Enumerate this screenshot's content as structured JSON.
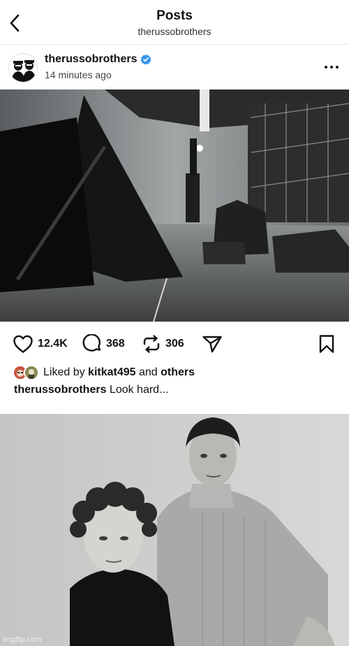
{
  "header": {
    "title": "Posts",
    "subtitle": "therussobrothers",
    "back_icon": "chevron-left-icon"
  },
  "post": {
    "username": "therussobrothers",
    "verified_icon": "verified-badge-icon",
    "verified_color": "#3897f0",
    "time": "14 minutes ago",
    "more_icon": "more-horizontal-icon",
    "image_icon": "studio-set-photo"
  },
  "actions": {
    "likes": "12.4K",
    "comments": "368",
    "reposts": "306",
    "like_icon": "heart-icon",
    "comment_icon": "comment-bubble-icon",
    "repost_icon": "repost-icon",
    "share_icon": "send-icon",
    "save_icon": "bookmark-icon"
  },
  "liked_by": {
    "prefix": "Liked by",
    "user": "kitkat495",
    "conjunction": "and",
    "others": "others"
  },
  "caption": {
    "username": "therussobrothers",
    "text": "Look hard..."
  },
  "meme": {
    "image_icon": "duo-portrait-photo",
    "watermark": "imgflip.com"
  }
}
